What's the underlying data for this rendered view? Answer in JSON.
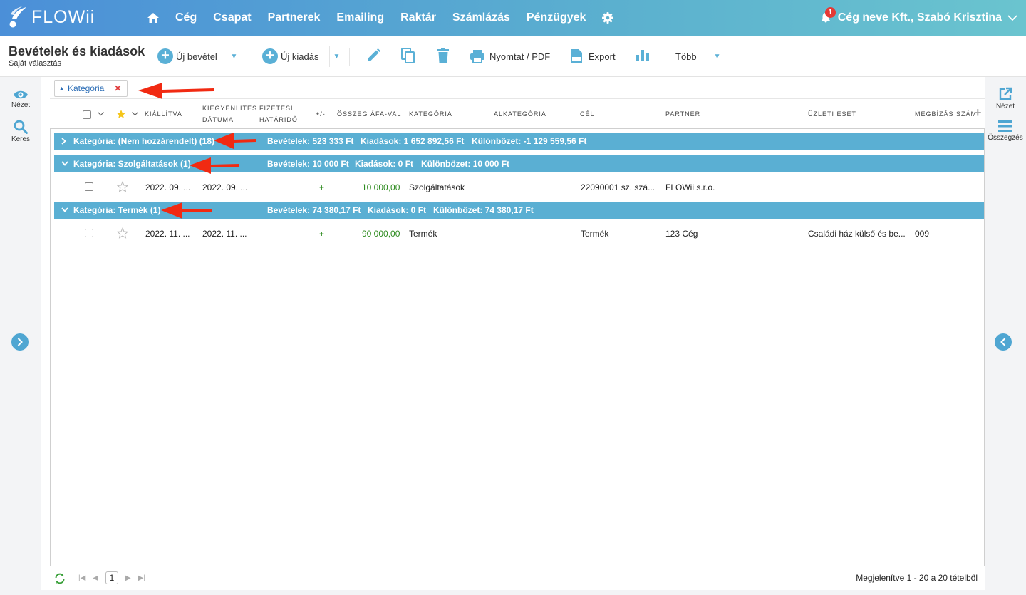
{
  "app": {
    "brand": "FLOWii",
    "nav": [
      "Cég",
      "Csapat",
      "Partnerek",
      "Emailing",
      "Raktár",
      "Számlázás",
      "Pénzügyek"
    ],
    "notifications": "1",
    "user": "Cég neve Kft., Szabó Krisztina",
    "colors": {
      "accent": "#5aafd3",
      "green": "#2e8b1f",
      "danger": "#e53935"
    }
  },
  "toolbar": {
    "title": "Bevételek és kiadások",
    "subtitle": "Saját választás",
    "new_income": "Új bevétel",
    "new_expense": "Új kiadás",
    "print": "Nyomtat / PDF",
    "export": "Export",
    "more": "Több"
  },
  "left_panel": {
    "view": "Nézet",
    "search": "Keres"
  },
  "right_panel": {
    "view": "Nézet",
    "summary": "Összegzés"
  },
  "grouping": {
    "chip_label": "Kategória"
  },
  "columns": {
    "issued": "Kiállítva",
    "settlement_1": "Kiegyenlítés",
    "settlement_2": "dátuma",
    "due_1": "Fizetési",
    "due_2": "határidő",
    "sign": "+/-",
    "gross": "Összeg ÁFA-val",
    "category": "Kategória",
    "subcategory": "Alkategória",
    "purpose": "Cél",
    "partner": "Partner",
    "case": "Üzleti eset",
    "order_no": "Megbízás szám"
  },
  "groups": [
    {
      "label": "Kategória: (Nem hozzárendelt) (18)",
      "income": "Bevételek: 523 333 Ft",
      "expense": "Kiadások: 1 652 892,56 Ft",
      "diff": "Különbözet: -1 129 559,56 Ft",
      "expanded": false
    },
    {
      "label": "Kategória: Szolgáltatások (1)",
      "income": "Bevételek: 10 000 Ft",
      "expense": "Kiadások: 0 Ft",
      "diff": "Különbözet: 10 000 Ft",
      "expanded": true,
      "row": {
        "issued": "2022. 09. ...",
        "settled": "2022. 09. ...",
        "sign": "+",
        "amount": "10 000,00",
        "category": "Szolgáltatások",
        "purpose": "22090001 sz. szá...",
        "partner": "FLOWii s.r.o.",
        "case": "",
        "order": ""
      }
    },
    {
      "label": "Kategória: Termék (1)",
      "income": "Bevételek: 74 380,17 Ft",
      "expense": "Kiadások: 0 Ft",
      "diff": "Különbözet: 74 380,17 Ft",
      "expanded": true,
      "row": {
        "issued": "2022. 11. ...",
        "settled": "2022. 11. ...",
        "sign": "+",
        "amount": "90 000,00",
        "category": "Termék",
        "purpose": "Termék",
        "partner": "123 Cég",
        "case": "Családi ház külső és be...",
        "order": "009"
      }
    }
  ],
  "footer": {
    "page": "1",
    "summary": "Megjelenítve 1 - 20 a 20 tételből"
  }
}
